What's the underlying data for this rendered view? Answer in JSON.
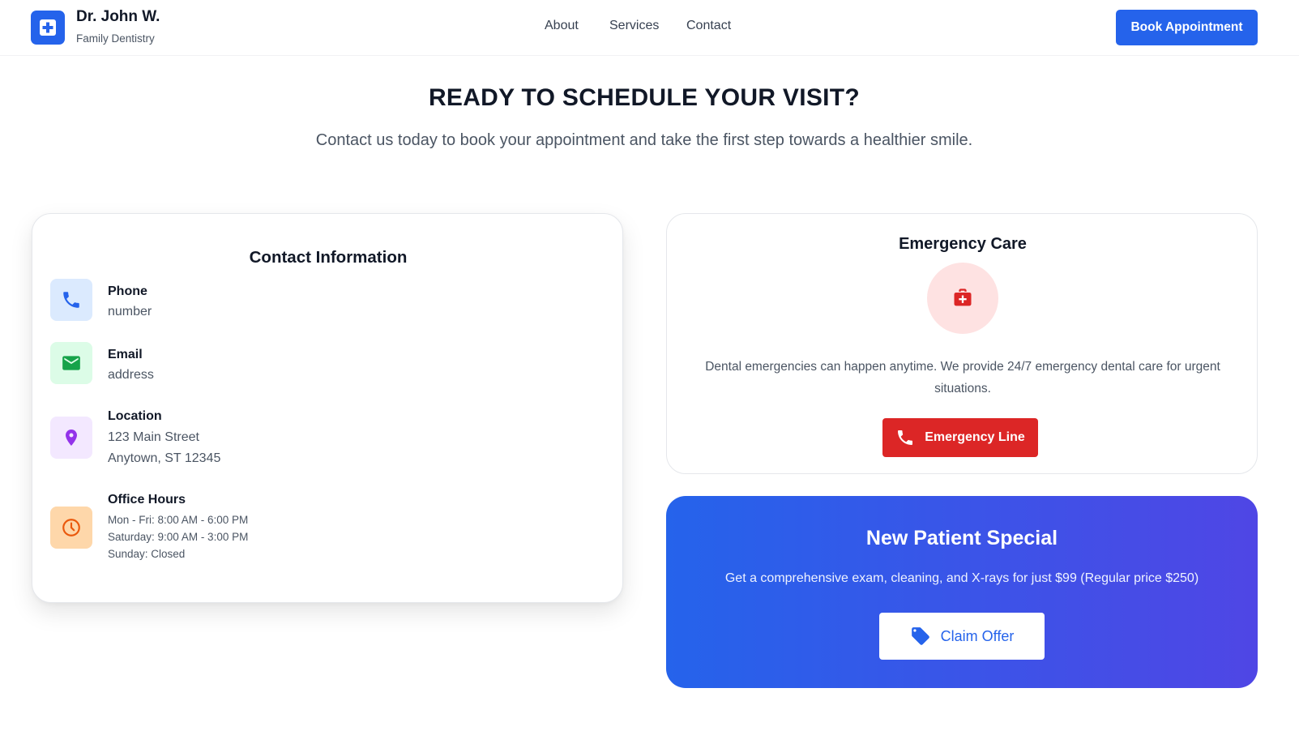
{
  "header": {
    "brand_name": "Dr. John W.",
    "brand_sub": "Family Dentistry",
    "nav": [
      "About",
      "Services",
      "Contact"
    ],
    "cta": "Book Appointment"
  },
  "hero": {
    "title": "READY TO SCHEDULE YOUR VISIT?",
    "subtitle": "Contact us today to book your appointment and take the first step towards a healthier smile."
  },
  "contact": {
    "title": "Contact Information",
    "phone": {
      "label": "Phone",
      "value": "number"
    },
    "email": {
      "label": "Email",
      "value": "address"
    },
    "location": {
      "label": "Location",
      "line1": "123 Main Street",
      "line2": "Anytown, ST 12345"
    },
    "hours": {
      "label": "Office Hours",
      "lines": [
        "Mon - Fri: 8:00 AM - 6:00 PM",
        "Saturday: 9:00 AM - 3:00 PM",
        "Sunday: Closed"
      ]
    }
  },
  "emergency": {
    "title": "Emergency Care",
    "description": "Dental emergencies can happen anytime. We provide 24/7 emergency dental care for urgent situations.",
    "button": "Emergency Line"
  },
  "special": {
    "title": "New Patient Special",
    "description": "Get a comprehensive exam, cleaning, and X-rays for just $99 (Regular price $250)",
    "button": "Claim Offer"
  },
  "colors": {
    "primary": "#2563eb",
    "danger": "#dc2626",
    "gradient_end": "#4f46e5"
  }
}
